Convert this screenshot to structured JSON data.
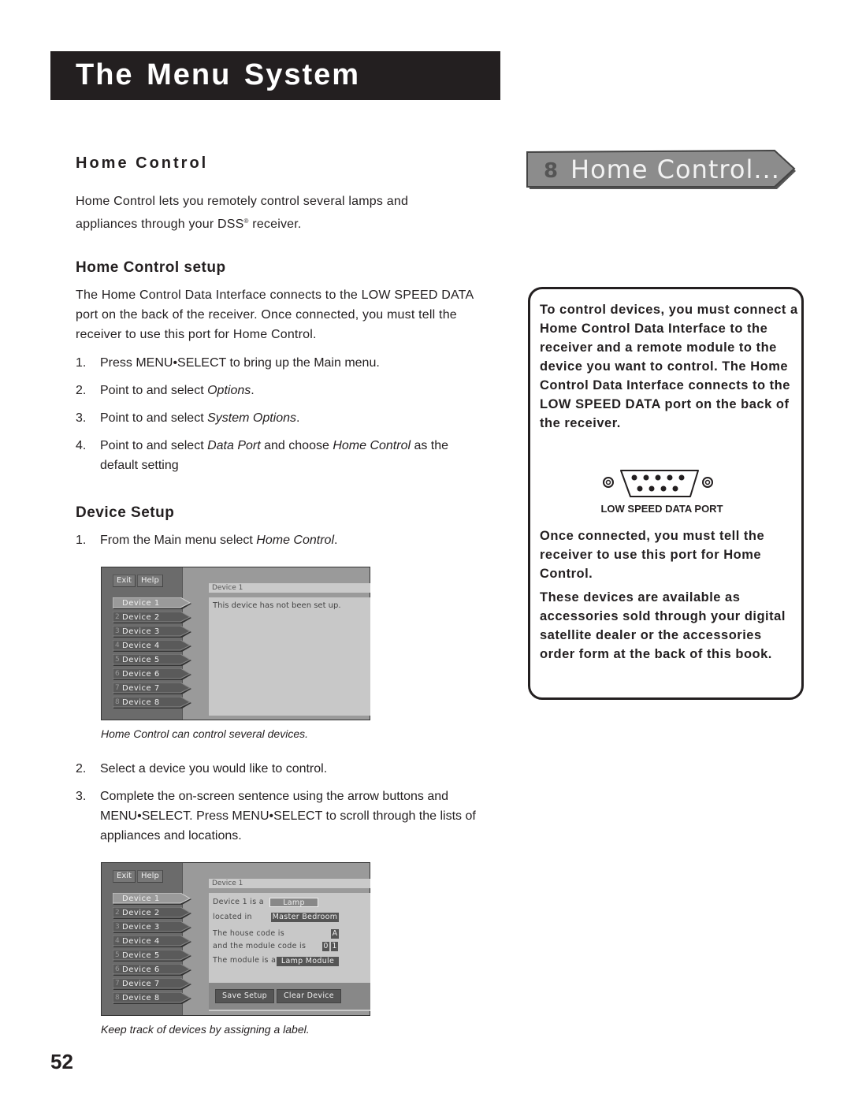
{
  "header": {
    "title": "The Menu System"
  },
  "banner": {
    "number": "8",
    "label": "Home Control..."
  },
  "sections": {
    "home_control": {
      "heading": "Home Control",
      "intro_line1": "Home Control lets you remotely control several lamps and",
      "intro_line2_a": "appliances through your DSS",
      "intro_reg": "®",
      "intro_line2_b": " receiver."
    },
    "setup": {
      "heading": "Home Control setup",
      "para": "The Home Control Data Interface connects to the LOW SPEED DATA port on the back of the receiver. Once connected, you must tell the receiver to use this port for Home Control.",
      "steps": [
        {
          "num": "1.",
          "pre": "Press MENU•SELECT to bring up the Main menu.",
          "em": "",
          "post": "",
          "em2": "",
          "post2": ""
        },
        {
          "num": "2.",
          "pre": "Point to and select ",
          "em": "Options",
          "post": ".",
          "em2": "",
          "post2": ""
        },
        {
          "num": "3.",
          "pre": "Point to and select ",
          "em": "System Options",
          "post": ".",
          "em2": "",
          "post2": ""
        },
        {
          "num": "4.",
          "pre": "Point to and select ",
          "em": "Data Port",
          "post": " and choose ",
          "em2": "Home Control",
          "post2": " as the default setting"
        }
      ]
    },
    "device_setup": {
      "heading": "Device Setup",
      "step1": {
        "num": "1.",
        "pre": "From the Main menu select ",
        "em": "Home Control",
        "post": "."
      },
      "caption1": "Home Control can control several devices.",
      "step2": {
        "num": "2.",
        "text": "Select a device you would like to control."
      },
      "step3": {
        "num": "3.",
        "text": "Complete the on-screen sentence using the arrow buttons and MENU•SELECT. Press MENU•SELECT to scroll through the lists of appliances and locations."
      },
      "caption2": "Keep track of devices by assigning a label."
    }
  },
  "note": {
    "para1": "To control devices, you must connect a Home Control Data Interface to the receiver and a remote module to the device you want to control. The Home Control Data Interface connects to the LOW SPEED DATA port on the back of the receiver.",
    "port_label": "LOW SPEED DATA PORT",
    "para2": "Once connected, you must tell the receiver to use this port for Home Control.",
    "para3": "These devices are available as accessories sold through your digital satellite dealer or the accessories order form at the back of this book."
  },
  "screen1": {
    "exit": "Exit",
    "help": "Help",
    "devices": [
      {
        "n": "1",
        "label": "Device 1",
        "selected": true
      },
      {
        "n": "2",
        "label": "Device 2",
        "selected": false
      },
      {
        "n": "3",
        "label": "Device 3",
        "selected": false
      },
      {
        "n": "4",
        "label": "Device 4",
        "selected": false
      },
      {
        "n": "5",
        "label": "Device 5",
        "selected": false
      },
      {
        "n": "6",
        "label": "Device 6",
        "selected": false
      },
      {
        "n": "7",
        "label": "Device 7",
        "selected": false
      },
      {
        "n": "8",
        "label": "Device 8",
        "selected": false
      }
    ],
    "header": "Device 1",
    "message": "This device has not been set up."
  },
  "screen2": {
    "exit": "Exit",
    "help": "Help",
    "header": "Device 1",
    "device_is_label": "Device 1 is a",
    "device_type": "Lamp",
    "located_label": "located in",
    "location": "Master Bedroom",
    "house_code_label": "The house code is",
    "house_code": "A",
    "module_code_label": "and the module code is",
    "module_code_1": "0",
    "module_code_2": "1",
    "module_label": "The module is a",
    "module": "Lamp Module",
    "save": "Save Setup",
    "clear": "Clear Device"
  },
  "footer": {
    "page_number": "52"
  }
}
